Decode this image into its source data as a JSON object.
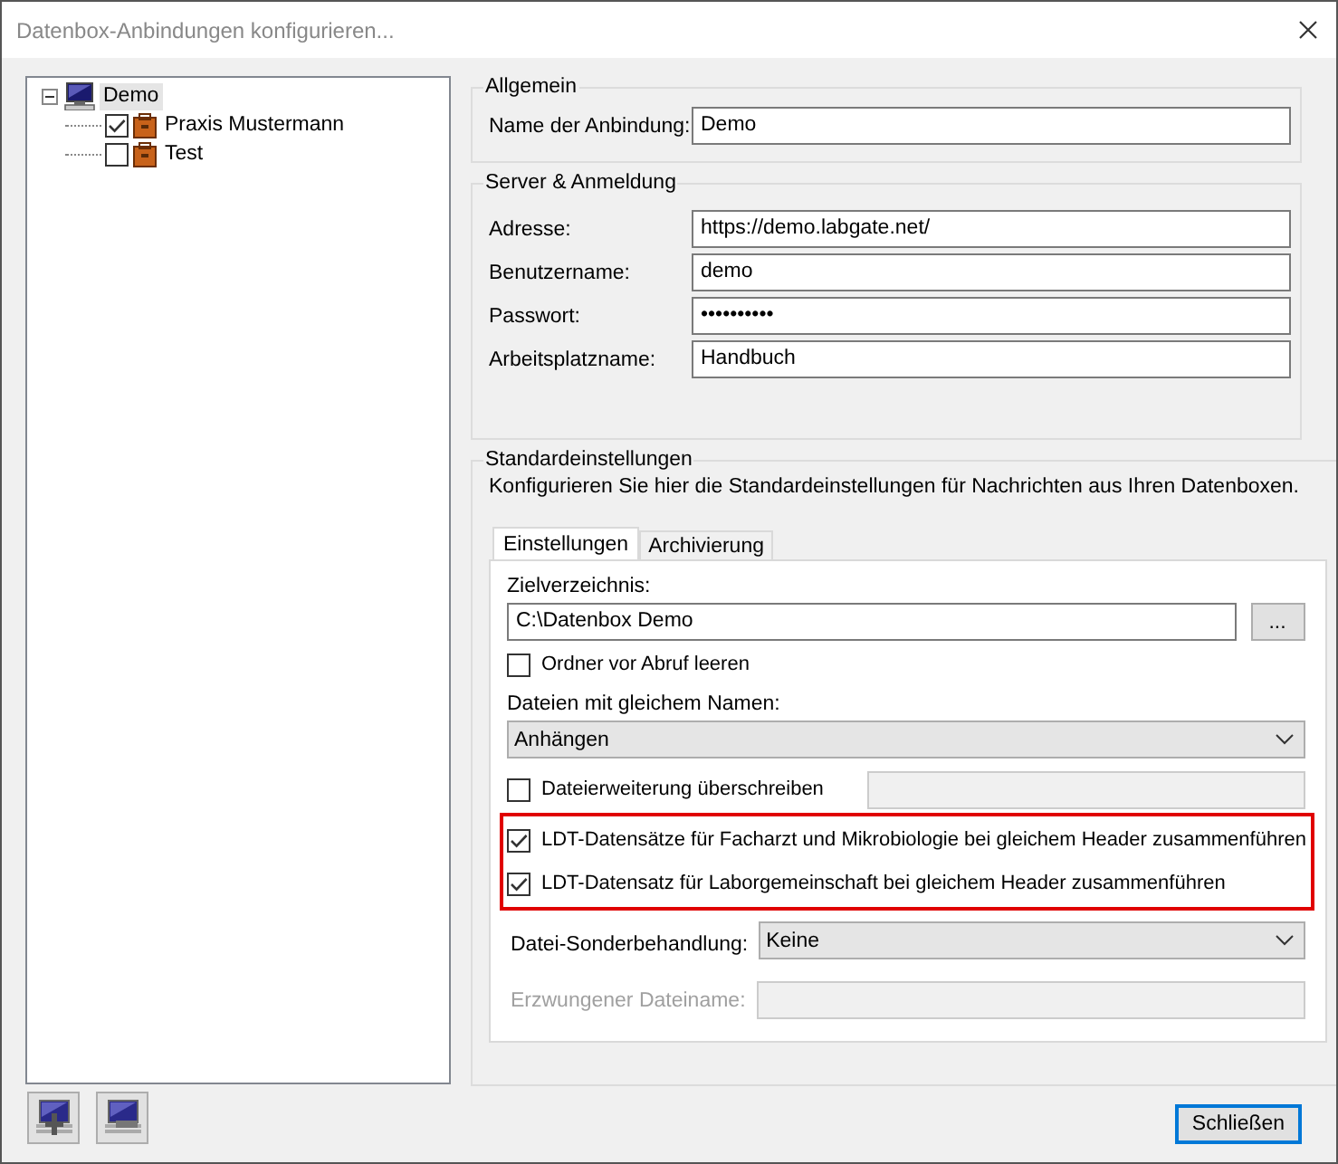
{
  "window": {
    "title": "Datenbox-Anbindungen konfigurieren..."
  },
  "tree": [
    {
      "label": "Demo",
      "selected": true,
      "expanded": true,
      "children": [
        {
          "label": "Praxis Mustermann",
          "checked": true,
          "selected": false
        },
        {
          "label": "Test",
          "checked": false,
          "selected": false
        }
      ]
    }
  ],
  "general": {
    "title": "Allgemein",
    "fields": [
      {
        "label": "Name der Anbindung:",
        "value": "Demo"
      }
    ]
  },
  "server": {
    "title": "Server & Anmeldung",
    "fields": [
      {
        "label": "Adresse:",
        "value": "https://demo.labgate.net/"
      },
      {
        "label": "Benutzername:",
        "value": "demo"
      },
      {
        "label": "Passwort:",
        "value": "••••••••••"
      },
      {
        "label": "Arbeitsplatzname:",
        "value": "Handbuch"
      }
    ]
  },
  "defaults": {
    "title": "Standardeinstellungen",
    "description": "Konfigurieren Sie hier die Standardeinstellungen für Nachrichten aus Ihren Datenboxen.",
    "tabs": [
      {
        "label": "Einstellungen",
        "selected": true
      },
      {
        "label": "Archivierung",
        "selected": false
      }
    ],
    "rows": [
      {
        "kind": "label",
        "text": "Zielverzeichnis:"
      },
      {
        "kind": "path",
        "value": "C:\\Datenbox Demo",
        "button": "..."
      },
      {
        "kind": "checkbox",
        "label": "Ordner vor Abruf leeren",
        "checked": false,
        "highlighted": false
      },
      {
        "kind": "label",
        "text": "Dateien mit gleichem Namen:"
      },
      {
        "kind": "select",
        "value": "Anhängen"
      },
      {
        "kind": "checkbox_field",
        "label": "Dateierweiterung überschreiben",
        "checked": false,
        "highlighted": false
      },
      {
        "kind": "checkbox",
        "label": "LDT-Datensätze für Facharzt und Mikrobiologie bei gleichem Header zusammenführen",
        "checked": true,
        "highlighted": true
      },
      {
        "kind": "checkbox",
        "label": "LDT-Datensatz für Laborgemeinschaft bei gleichem Header zusammenführen",
        "checked": true,
        "highlighted": true
      },
      {
        "kind": "labeled_select",
        "label": "Datei-Sonderbehandlung:",
        "value": "Keine",
        "disabled": false
      },
      {
        "kind": "labeled_field",
        "label": "Erzwungener Dateiname:",
        "disabled": true
      }
    ]
  },
  "close_button": {
    "label": "Schließen",
    "default": true
  }
}
